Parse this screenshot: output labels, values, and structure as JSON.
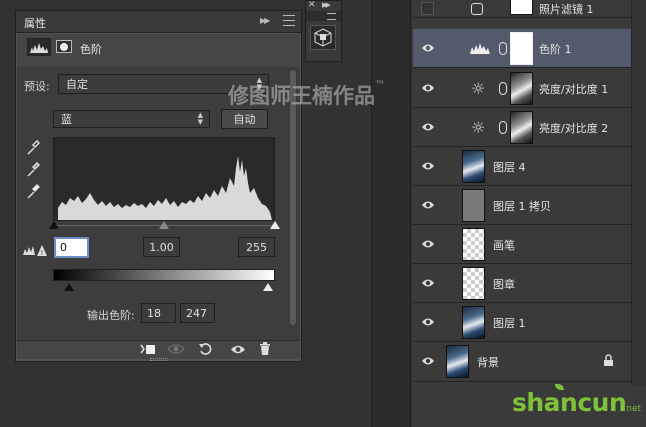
{
  "properties": {
    "tab_title": "属性",
    "panel_name": "色阶",
    "preset_label": "预设:",
    "preset_value": "自定",
    "channel_value": "蓝",
    "auto_button": "自动",
    "input_black": "0",
    "input_gamma": "1.00",
    "input_white": "255",
    "output_label": "输出色阶:",
    "output_black": "18",
    "output_white": "247"
  },
  "watermark": {
    "text": "修图师王楠作品",
    "tm": "™"
  },
  "brand": {
    "logo_text": "shancun",
    "logo_sub": "net"
  },
  "layers": [
    {
      "name": "照片滤镜 1",
      "visible": false,
      "type": "adjustment"
    },
    {
      "name": "色阶 1",
      "visible": true,
      "type": "levels",
      "selected": true
    },
    {
      "name": "亮度/对比度 1",
      "visible": true,
      "type": "brightness"
    },
    {
      "name": "亮度/对比度 2",
      "visible": true,
      "type": "brightness"
    },
    {
      "name": "图层 4",
      "visible": true,
      "type": "photo"
    },
    {
      "name": "图层 1 拷贝",
      "visible": true,
      "type": "gray"
    },
    {
      "name": "画笔",
      "visible": true,
      "type": "transparent"
    },
    {
      "name": "图章",
      "visible": true,
      "type": "transparent"
    },
    {
      "name": "图层 1",
      "visible": true,
      "type": "photo"
    },
    {
      "name": "背景",
      "visible": true,
      "type": "background"
    }
  ]
}
